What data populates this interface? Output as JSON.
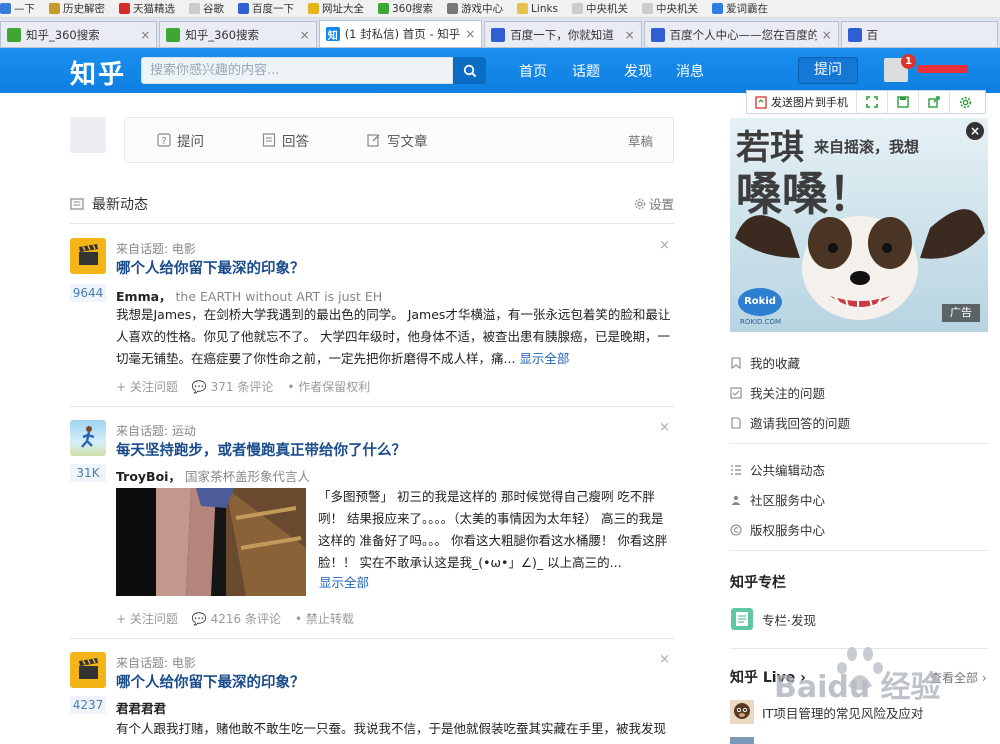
{
  "browser": {
    "bookmarks": [
      {
        "label": "—下",
        "color": "#3b7bd8"
      },
      {
        "label": "历史解密",
        "color": "#c49a2a"
      },
      {
        "label": "天猫精选",
        "color": "#d62b2b"
      },
      {
        "label": "谷歌",
        "color": "#cccccc"
      },
      {
        "label": "百度一下",
        "color": "#2f5fd0"
      },
      {
        "label": "网址大全",
        "color": "#e3b41b"
      },
      {
        "label": "360搜索",
        "color": "#3fa535"
      },
      {
        "label": "游戏中心",
        "color": "#777777"
      },
      {
        "label": "Links",
        "color": "#e8c34a"
      },
      {
        "label": "中央机关",
        "color": "#cccccc"
      },
      {
        "label": "中央机关",
        "color": "#cccccc"
      },
      {
        "label": "爱词霸在",
        "color": "#2f7de0"
      }
    ],
    "tabs": [
      {
        "label": "知乎_360搜索",
        "fav_color": "#3fa535",
        "fav_char": "",
        "active": false
      },
      {
        "label": "知乎_360搜索",
        "fav_color": "#3fa535",
        "fav_char": "",
        "active": false
      },
      {
        "label": "(1 封私信) 首页 - 知乎",
        "fav_color": "#0f88eb",
        "fav_char": "知",
        "active": true
      },
      {
        "label": "百度一下，你就知道",
        "fav_color": "#2f5fd0",
        "fav_char": "",
        "active": false
      },
      {
        "label": "百度个人中心——您在百度的",
        "fav_color": "#2f5fd0",
        "fav_char": "",
        "active": false
      },
      {
        "label": "百",
        "fav_color": "#2f5fd0",
        "fav_char": "",
        "active": false
      }
    ]
  },
  "header": {
    "logo": "知乎",
    "search_placeholder": "搜索你感兴趣的内容...",
    "nav": [
      "首页",
      "话题",
      "发现",
      "消息"
    ],
    "ask_label": "提问",
    "notification_count": "1"
  },
  "sharebar": {
    "send_label": "发送图片到手机"
  },
  "compose": {
    "ask": "提问",
    "answer": "回答",
    "write": "写文章",
    "draft": "草稿"
  },
  "feed": {
    "title": "最新动态",
    "settings": "设置",
    "items": [
      {
        "source": "来自话题: 电影",
        "title": "哪个人给你留下最深的印象？",
        "votes": "9644",
        "author": "Emma，",
        "bio": "the EARTH without ART is just EH",
        "body": "我想是James，在剑桥大学我遇到的最出色的同学。 James才华横溢，有一张永远包着笑的脸和最让人喜欢的性格。你见了他就忘不了。 大学四年级时，他身体不适，被查出患有胰腺癌，已是晚期，一切毫无铺垫。在癌症要了你性命之前，一定先把你折磨得不成人样，痛...",
        "more": "显示全部",
        "meta": [
          "+ 关注问题",
          "371 条评论",
          "• 作者保留权利"
        ]
      },
      {
        "source": "来自话题: 运动",
        "title": "每天坚持跑步，或者慢跑真正带给你了什么？",
        "votes": "31K",
        "author": "TroyBoi，",
        "bio": "国家茶杯盖形象代言人",
        "body": "「多图预警」 初三的我是这样的 那时候觉得自己瘦咧 吃不胖咧！ 结果报应来了。。。。（太美的事情因为太年轻） 高三的我是这样的 准备好了吗。。。 你看这大粗腿你看这水桶腰！ 你看这胖脸！！ 实在不敢承认这是我_(•ω•」∠)_ 以上高三的...",
        "more": "显示全部",
        "meta": [
          "+ 关注问题",
          "4216 条评论",
          "• 禁止转载"
        ]
      },
      {
        "source": "来自话题: 电影",
        "title": "哪个人给你留下最深的印象？",
        "votes": "4237",
        "author": "君君君君",
        "bio": "",
        "body": "有个人跟我打赌，赌他敢不敢生吃一只蚕。我说我不信，于是他就假装吃蚕其实藏在手里，被我发现",
        "more": "",
        "meta": []
      }
    ]
  },
  "sidebar": {
    "ad": {
      "brand": "若琪",
      "tagline": "来自摇滚，我想",
      "headline": "嗓嗓！",
      "logo": "Rokid",
      "site": "ROKID.COM",
      "tag": "广告"
    },
    "links1": [
      "我的收藏",
      "我关注的问题",
      "邀请我回答的问题"
    ],
    "links2": [
      "公共编辑动态",
      "社区服务中心",
      "版权服务中心"
    ],
    "column_heading": "知乎专栏",
    "column_item": "专栏·发现",
    "live_heading": "知乎 Live ›",
    "live_more": "查看全部 ›",
    "live_item": "IT项目管理的常见风险及应对",
    "watermark": "Baidu 经验"
  }
}
